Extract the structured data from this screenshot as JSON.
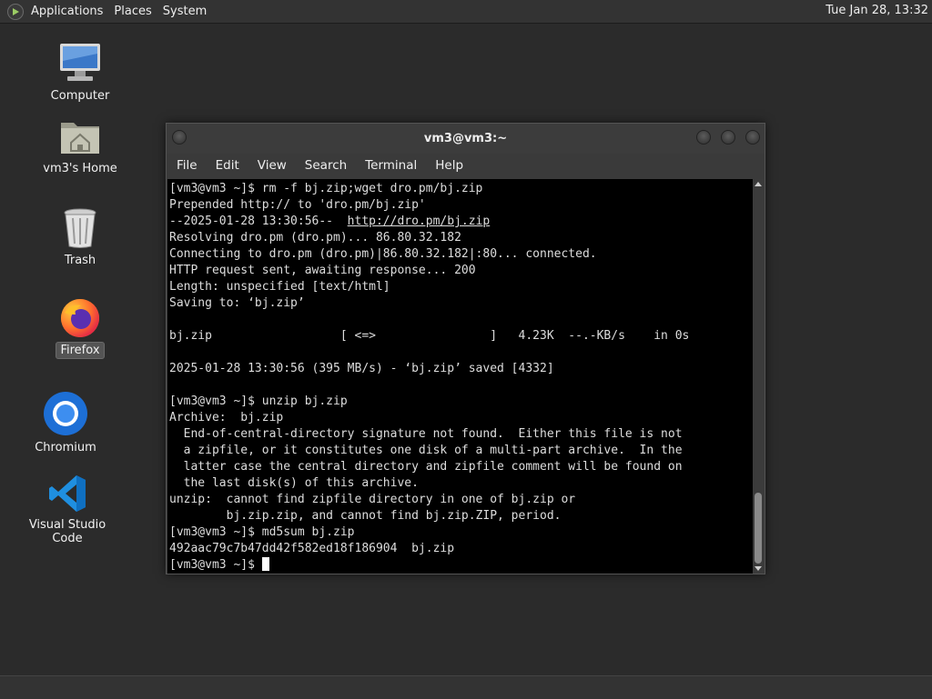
{
  "top_panel": {
    "menus": [
      "Applications",
      "Places",
      "System"
    ],
    "clock": "Tue Jan 28, 13:32"
  },
  "desktop": {
    "icons": [
      {
        "label": "Computer",
        "icon": "computer-icon"
      },
      {
        "label": "vm3's Home",
        "icon": "home-folder-icon"
      },
      {
        "label": "Trash",
        "icon": "trash-icon"
      },
      {
        "label": "Firefox",
        "icon": "firefox-icon",
        "selected": true
      },
      {
        "label": "Chromium",
        "icon": "chromium-icon"
      },
      {
        "label": "Visual Studio Code",
        "icon": "vscode-icon"
      }
    ]
  },
  "window": {
    "title": "vm3@vm3:~",
    "menu": [
      "File",
      "Edit",
      "View",
      "Search",
      "Terminal",
      "Help"
    ]
  },
  "terminal": {
    "lines": [
      "[vm3@vm3 ~]$ rm -f bj.zip;wget dro.pm/bj.zip",
      "Prepended http:// to 'dro.pm/bj.zip'",
      "--2025-01-28 13:30:56--  ",
      "Resolving dro.pm (dro.pm)... 86.80.32.182",
      "Connecting to dro.pm (dro.pm)|86.80.32.182|:80... connected.",
      "HTTP request sent, awaiting response... 200",
      "Length: unspecified [text/html]",
      "Saving to: ‘bj.zip’",
      "",
      "bj.zip                  [ <=>                ]   4.23K  --.-KB/s    in 0s",
      "",
      "2025-01-28 13:30:56 (395 MB/s) - ‘bj.zip’ saved [4332]",
      "",
      "[vm3@vm3 ~]$ unzip bj.zip",
      "Archive:  bj.zip",
      "  End-of-central-directory signature not found.  Either this file is not",
      "  a zipfile, or it constitutes one disk of a multi-part archive.  In the",
      "  latter case the central directory and zipfile comment will be found on",
      "  the last disk(s) of this archive.",
      "unzip:  cannot find zipfile directory in one of bj.zip or",
      "        bj.zip.zip, and cannot find bj.zip.ZIP, period.",
      "[vm3@vm3 ~]$ md5sum bj.zip",
      "492aac79c7b47dd42f582ed18f186904  bj.zip",
      "[vm3@vm3 ~]$ "
    ],
    "url": "http://dro.pm/bj.zip"
  }
}
